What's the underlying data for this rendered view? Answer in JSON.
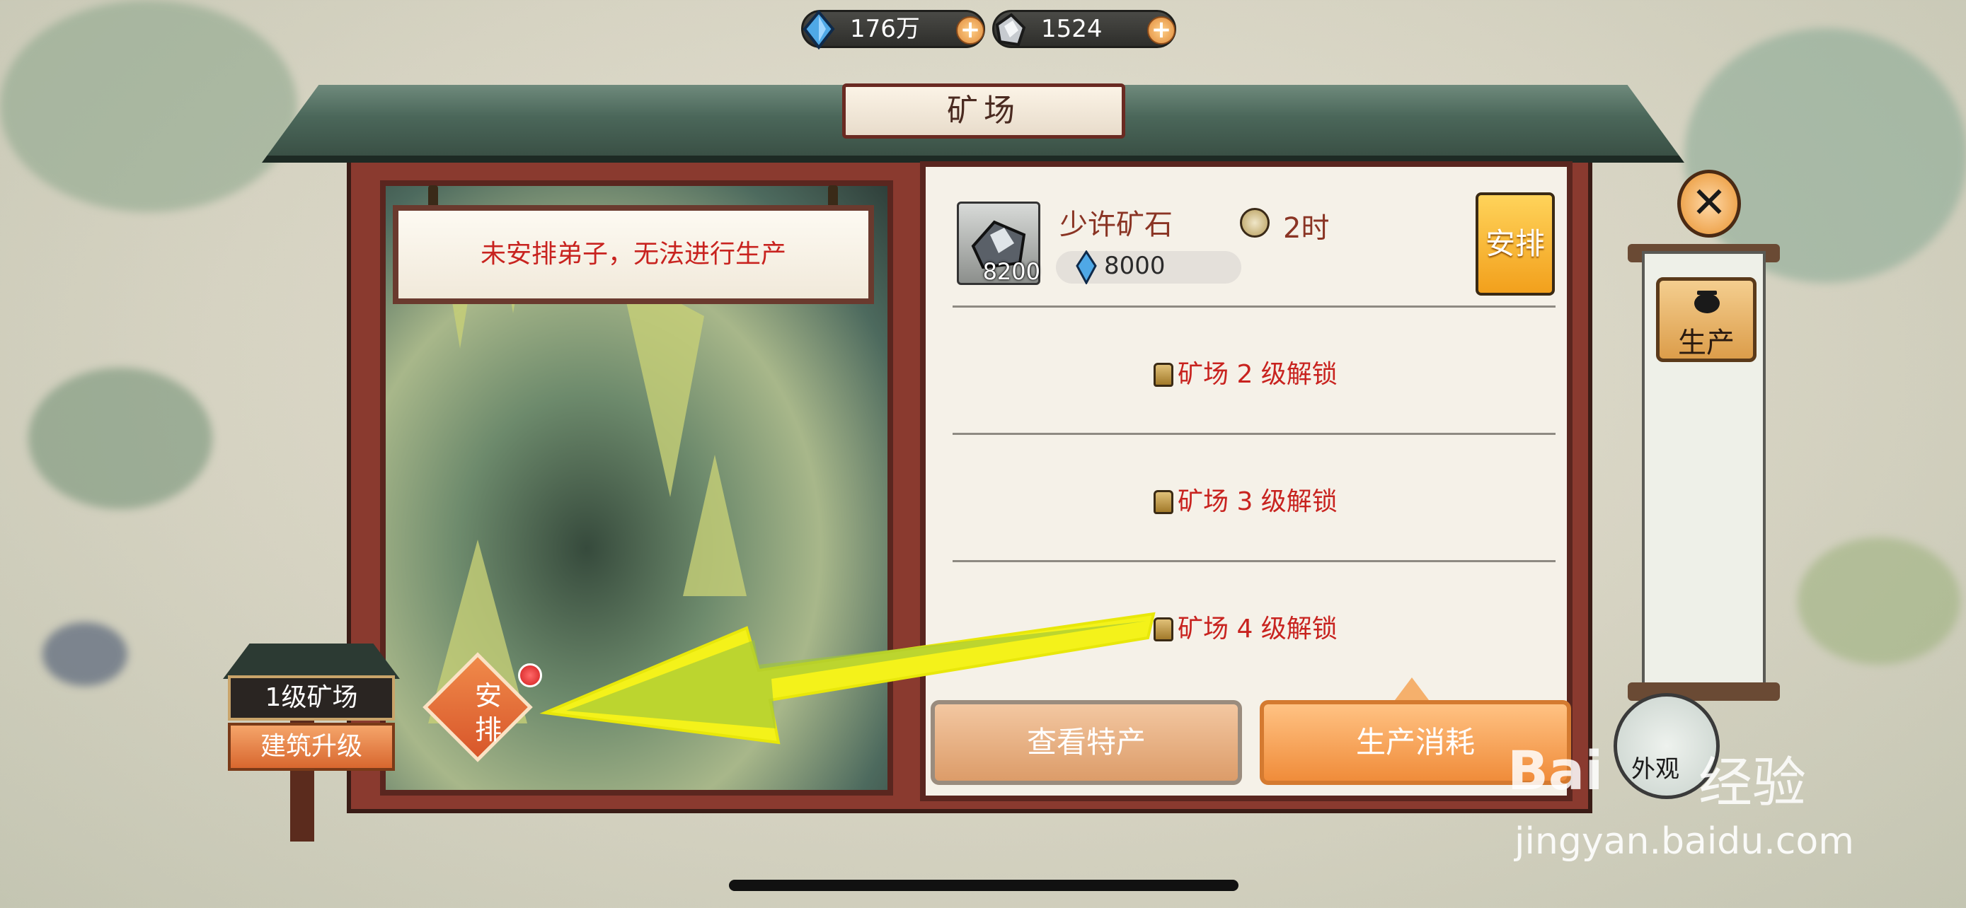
{
  "currencies": [
    {
      "icon": "blue-crystal-icon",
      "value": "176万"
    },
    {
      "icon": "ore-icon",
      "value": "1524"
    }
  ],
  "window": {
    "title": "矿场",
    "notice": "未安排弟子，无法进行生产"
  },
  "cave": {
    "arrange_label": "安\n排"
  },
  "building": {
    "level": "1级矿场",
    "upgrade_label": "建筑升级"
  },
  "production": {
    "item_name": "少许矿石",
    "item_qty": "8200",
    "duration": "2时",
    "cost_value": "8000",
    "arrange_button": "安排",
    "locked_slots": [
      "矿场 2 级解锁",
      "矿场 3 级解锁",
      "矿场 4 级解锁"
    ]
  },
  "buttons": {
    "specialty": "查看特产",
    "consume": "生产消耗",
    "produce": "生产",
    "appearance": "外观",
    "close": "✕"
  },
  "watermark": {
    "logo": "Bai",
    "text": "经验",
    "url": "jingyan.baidu.com"
  },
  "colors": {
    "accent_orange": "#f08c3a",
    "lock_red": "#c8231f",
    "frame": "#8a3a2f",
    "arrow": "#f4f21a"
  }
}
